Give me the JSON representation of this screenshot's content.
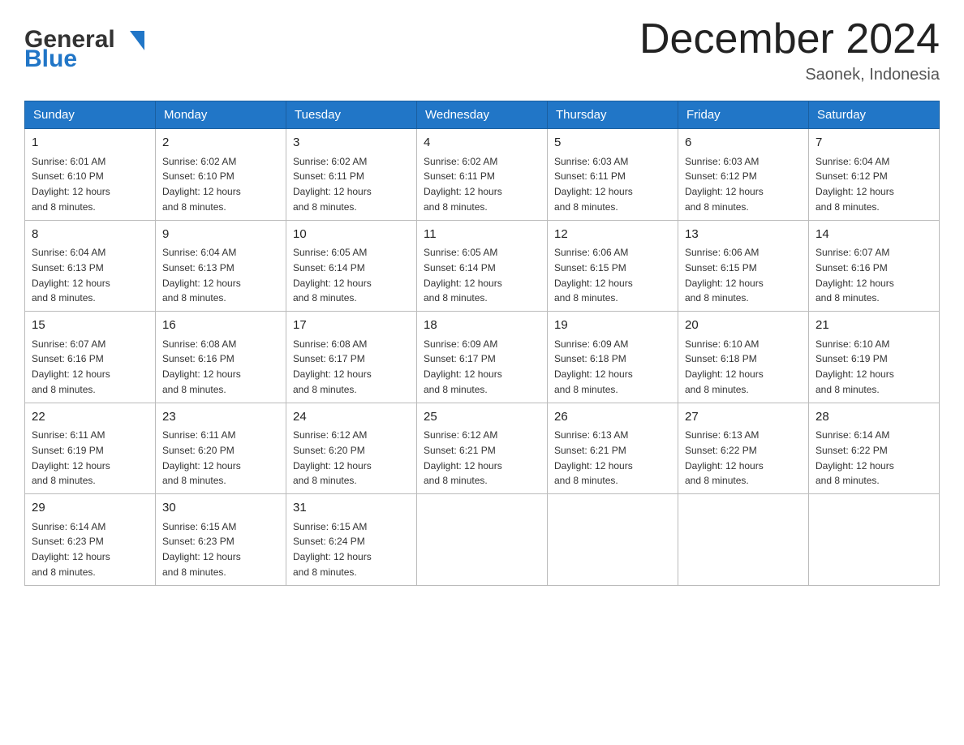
{
  "logo": {
    "text_general": "General",
    "text_blue": "Blue"
  },
  "title": "December 2024",
  "subtitle": "Saonek, Indonesia",
  "days_of_week": [
    "Sunday",
    "Monday",
    "Tuesday",
    "Wednesday",
    "Thursday",
    "Friday",
    "Saturday"
  ],
  "weeks": [
    [
      {
        "day": "1",
        "sunrise": "6:01 AM",
        "sunset": "6:10 PM",
        "daylight": "12 hours and 8 minutes."
      },
      {
        "day": "2",
        "sunrise": "6:02 AM",
        "sunset": "6:10 PM",
        "daylight": "12 hours and 8 minutes."
      },
      {
        "day": "3",
        "sunrise": "6:02 AM",
        "sunset": "6:11 PM",
        "daylight": "12 hours and 8 minutes."
      },
      {
        "day": "4",
        "sunrise": "6:02 AM",
        "sunset": "6:11 PM",
        "daylight": "12 hours and 8 minutes."
      },
      {
        "day": "5",
        "sunrise": "6:03 AM",
        "sunset": "6:11 PM",
        "daylight": "12 hours and 8 minutes."
      },
      {
        "day": "6",
        "sunrise": "6:03 AM",
        "sunset": "6:12 PM",
        "daylight": "12 hours and 8 minutes."
      },
      {
        "day": "7",
        "sunrise": "6:04 AM",
        "sunset": "6:12 PM",
        "daylight": "12 hours and 8 minutes."
      }
    ],
    [
      {
        "day": "8",
        "sunrise": "6:04 AM",
        "sunset": "6:13 PM",
        "daylight": "12 hours and 8 minutes."
      },
      {
        "day": "9",
        "sunrise": "6:04 AM",
        "sunset": "6:13 PM",
        "daylight": "12 hours and 8 minutes."
      },
      {
        "day": "10",
        "sunrise": "6:05 AM",
        "sunset": "6:14 PM",
        "daylight": "12 hours and 8 minutes."
      },
      {
        "day": "11",
        "sunrise": "6:05 AM",
        "sunset": "6:14 PM",
        "daylight": "12 hours and 8 minutes."
      },
      {
        "day": "12",
        "sunrise": "6:06 AM",
        "sunset": "6:15 PM",
        "daylight": "12 hours and 8 minutes."
      },
      {
        "day": "13",
        "sunrise": "6:06 AM",
        "sunset": "6:15 PM",
        "daylight": "12 hours and 8 minutes."
      },
      {
        "day": "14",
        "sunrise": "6:07 AM",
        "sunset": "6:16 PM",
        "daylight": "12 hours and 8 minutes."
      }
    ],
    [
      {
        "day": "15",
        "sunrise": "6:07 AM",
        "sunset": "6:16 PM",
        "daylight": "12 hours and 8 minutes."
      },
      {
        "day": "16",
        "sunrise": "6:08 AM",
        "sunset": "6:16 PM",
        "daylight": "12 hours and 8 minutes."
      },
      {
        "day": "17",
        "sunrise": "6:08 AM",
        "sunset": "6:17 PM",
        "daylight": "12 hours and 8 minutes."
      },
      {
        "day": "18",
        "sunrise": "6:09 AM",
        "sunset": "6:17 PM",
        "daylight": "12 hours and 8 minutes."
      },
      {
        "day": "19",
        "sunrise": "6:09 AM",
        "sunset": "6:18 PM",
        "daylight": "12 hours and 8 minutes."
      },
      {
        "day": "20",
        "sunrise": "6:10 AM",
        "sunset": "6:18 PM",
        "daylight": "12 hours and 8 minutes."
      },
      {
        "day": "21",
        "sunrise": "6:10 AM",
        "sunset": "6:19 PM",
        "daylight": "12 hours and 8 minutes."
      }
    ],
    [
      {
        "day": "22",
        "sunrise": "6:11 AM",
        "sunset": "6:19 PM",
        "daylight": "12 hours and 8 minutes."
      },
      {
        "day": "23",
        "sunrise": "6:11 AM",
        "sunset": "6:20 PM",
        "daylight": "12 hours and 8 minutes."
      },
      {
        "day": "24",
        "sunrise": "6:12 AM",
        "sunset": "6:20 PM",
        "daylight": "12 hours and 8 minutes."
      },
      {
        "day": "25",
        "sunrise": "6:12 AM",
        "sunset": "6:21 PM",
        "daylight": "12 hours and 8 minutes."
      },
      {
        "day": "26",
        "sunrise": "6:13 AM",
        "sunset": "6:21 PM",
        "daylight": "12 hours and 8 minutes."
      },
      {
        "day": "27",
        "sunrise": "6:13 AM",
        "sunset": "6:22 PM",
        "daylight": "12 hours and 8 minutes."
      },
      {
        "day": "28",
        "sunrise": "6:14 AM",
        "sunset": "6:22 PM",
        "daylight": "12 hours and 8 minutes."
      }
    ],
    [
      {
        "day": "29",
        "sunrise": "6:14 AM",
        "sunset": "6:23 PM",
        "daylight": "12 hours and 8 minutes."
      },
      {
        "day": "30",
        "sunrise": "6:15 AM",
        "sunset": "6:23 PM",
        "daylight": "12 hours and 8 minutes."
      },
      {
        "day": "31",
        "sunrise": "6:15 AM",
        "sunset": "6:24 PM",
        "daylight": "12 hours and 8 minutes."
      },
      null,
      null,
      null,
      null
    ]
  ],
  "labels": {
    "sunrise": "Sunrise:",
    "sunset": "Sunset:",
    "daylight": "Daylight:"
  }
}
